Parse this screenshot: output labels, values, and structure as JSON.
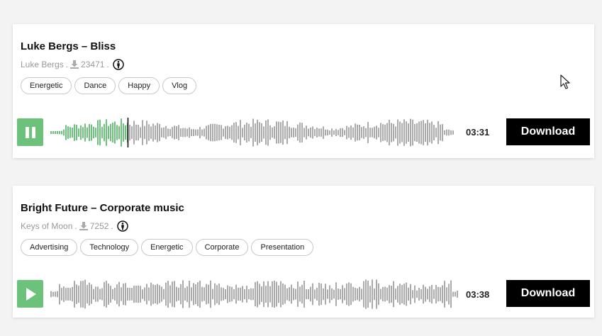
{
  "tracks": [
    {
      "title": "Luke Bergs – Bliss",
      "artist": "Luke Bergs",
      "sep1": ".",
      "downloads": "23471",
      "sep2": ".",
      "tags": [
        "Energetic",
        "Dance",
        "Happy",
        "Vlog"
      ],
      "state": "playing",
      "play_icon": "pause-icon",
      "progress": 0.19,
      "duration": "03:31",
      "download_label": "Download"
    },
    {
      "title": "Bright Future – Corporate music",
      "artist": "Keys of Moon",
      "sep1": ".",
      "downloads": "7252",
      "sep2": ".",
      "tags": [
        "Advertising",
        "Technology",
        "Energetic",
        "Corporate",
        "Presentation"
      ],
      "state": "paused",
      "play_icon": "play-icon",
      "progress": 0,
      "duration": "03:38",
      "download_label": "Download"
    }
  ],
  "colors": {
    "accent": "#6cc27a",
    "wave_played": "#6cc27a",
    "wave_unplayed": "#aaaaaa",
    "playhead": "#000000",
    "download_bg": "#000000",
    "muted_text": "#999999"
  }
}
